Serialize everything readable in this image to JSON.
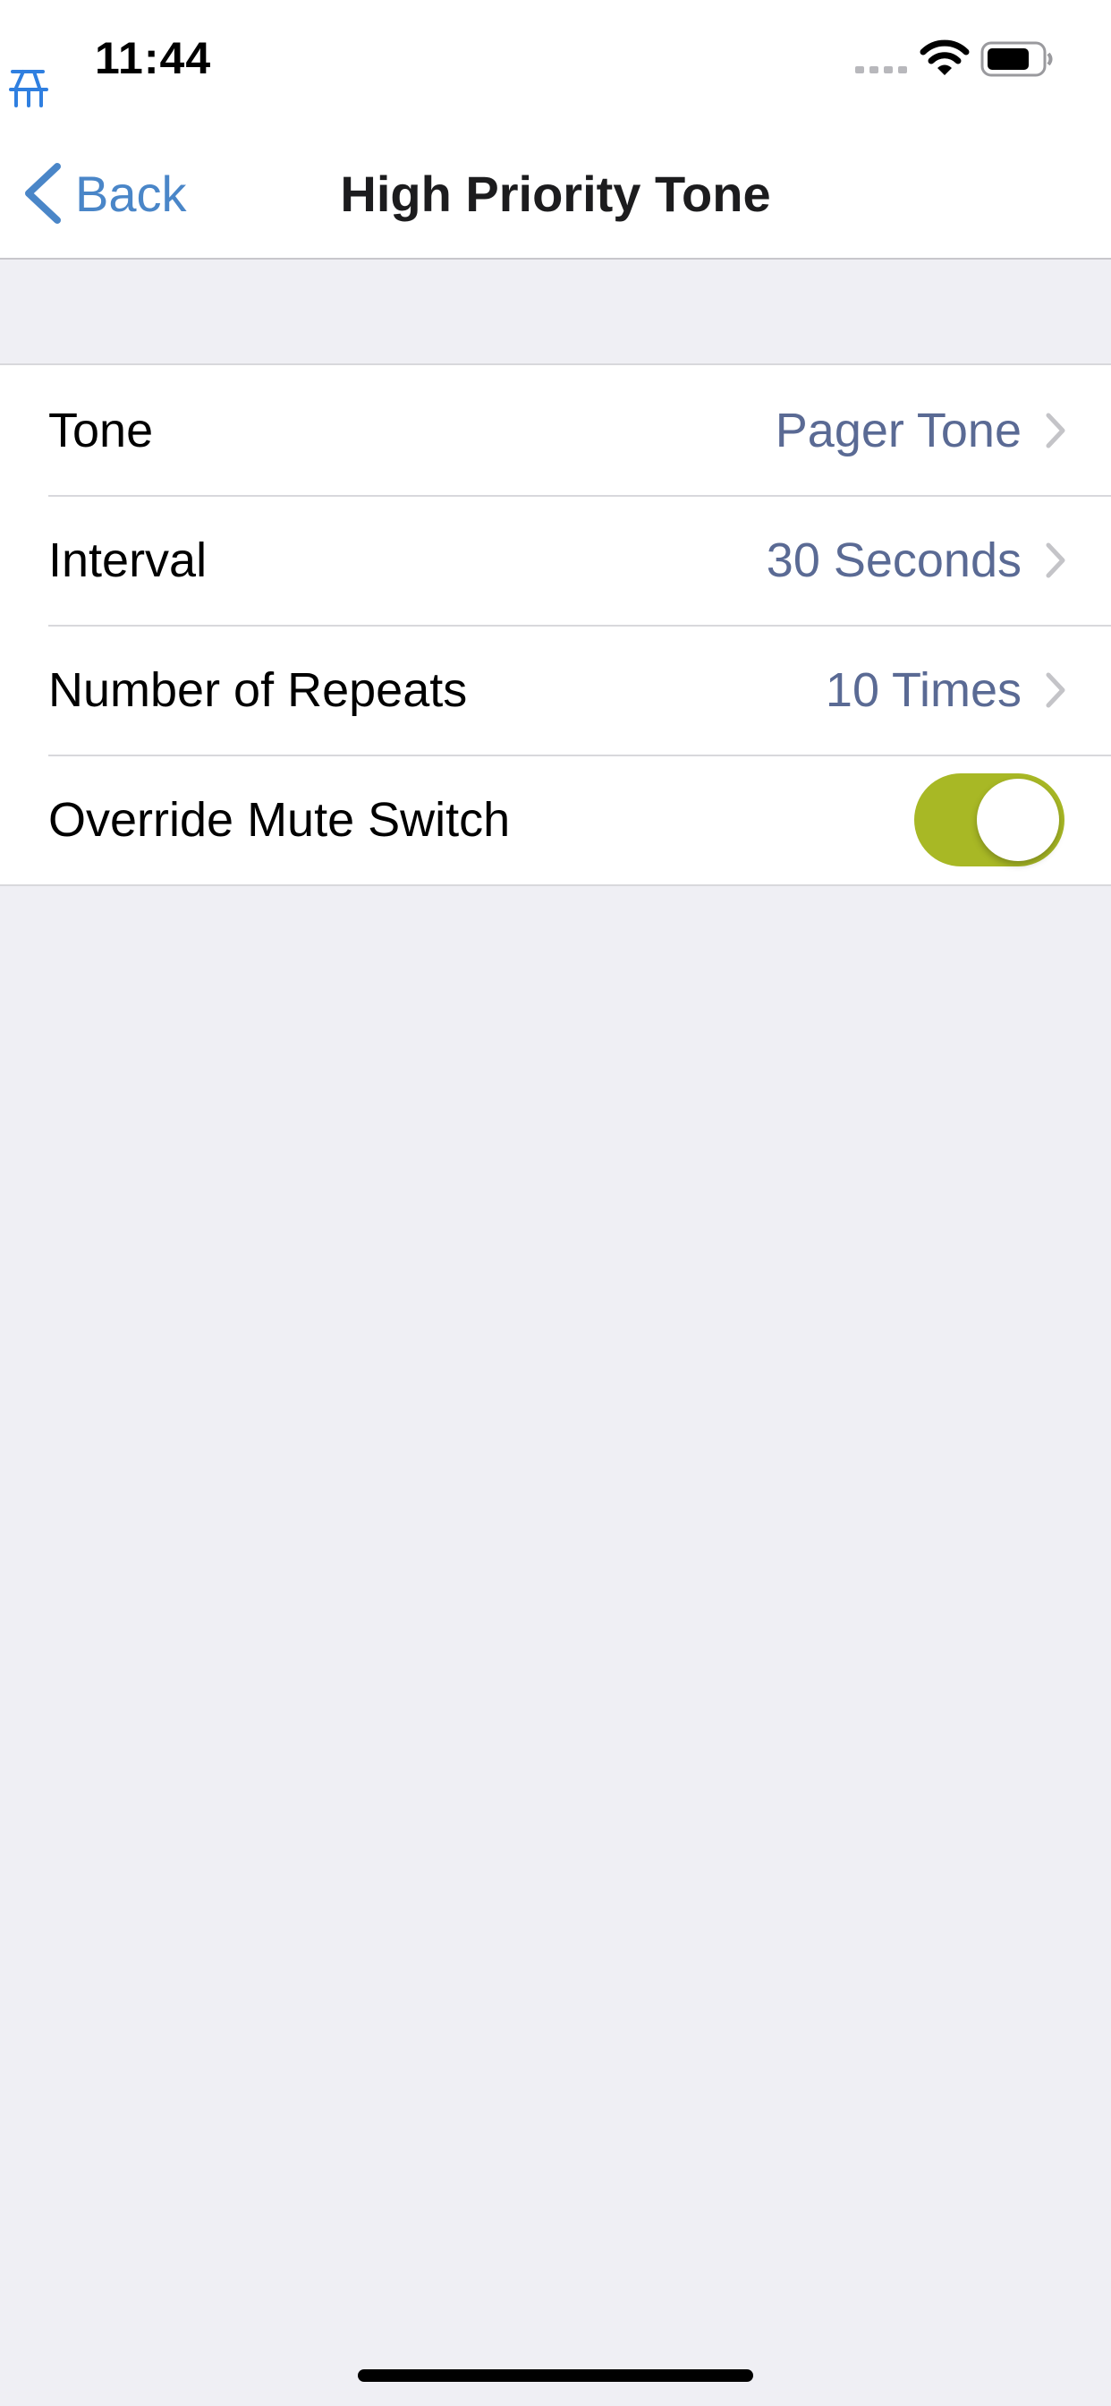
{
  "status_bar": {
    "time": "11:44"
  },
  "nav": {
    "back_label": "Back",
    "title": "High Priority Tone"
  },
  "settings": {
    "rows": [
      {
        "label": "Tone",
        "value": "Pager Tone"
      },
      {
        "label": "Interval",
        "value": "30 Seconds"
      },
      {
        "label": "Number of Repeats",
        "value": "10 Times"
      }
    ],
    "override": {
      "label": "Override Mute Switch",
      "enabled": true
    }
  },
  "colors": {
    "accent": "#4A86C8",
    "value_text": "#5A6A94",
    "toggle_on": "#A8B825",
    "background": "#EFEFF4"
  }
}
